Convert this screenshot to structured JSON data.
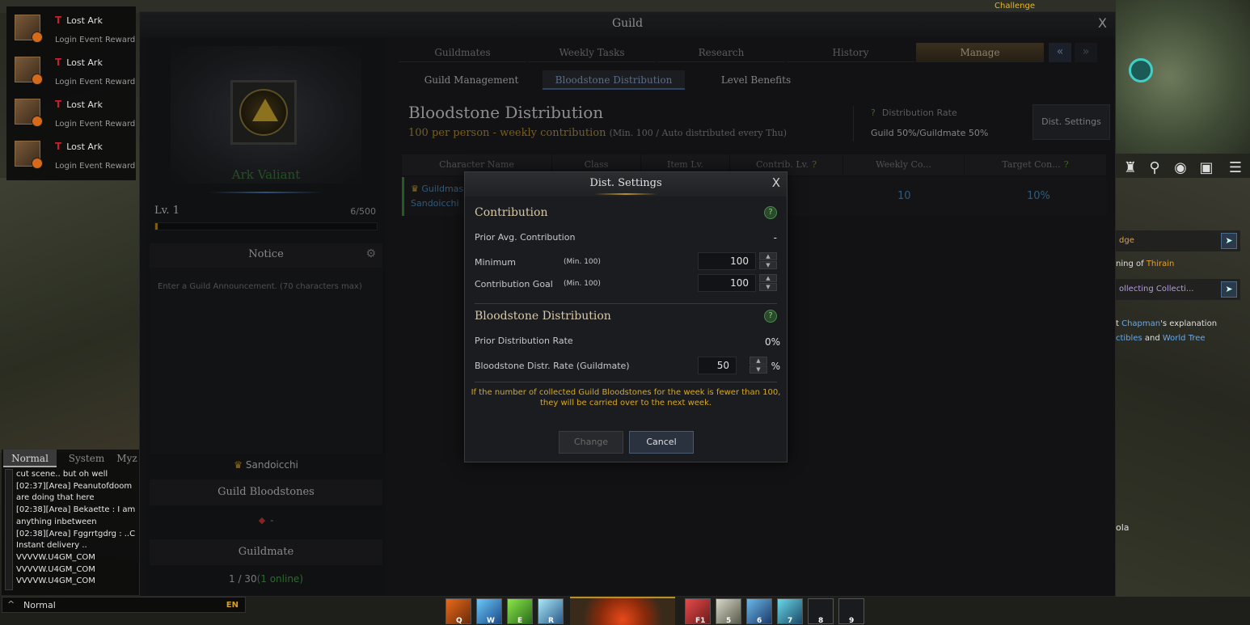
{
  "event_rewards": [
    {
      "title": "Lost Ark",
      "subtitle": "Login Event Reward"
    },
    {
      "title": "Lost Ark",
      "subtitle": "Login Event Reward"
    },
    {
      "title": "Lost Ark",
      "subtitle": "Login Event Reward"
    },
    {
      "title": "Lost Ark",
      "subtitle": "Login Event Reward"
    }
  ],
  "challenge_label": "Challenge",
  "chat": {
    "tabs": [
      "Normal",
      "System",
      "Myz"
    ],
    "lines": [
      "cut scene.. but oh well",
      "[02:37][Area] Peanutofdoom",
      "are doing that here",
      "[02:38][Area] Bekaette : I am",
      "anything inbetween",
      "[02:38][Area] Fggrrtgdrg : ..C",
      "Instant delivery ..",
      "VVVVW.U4GM_COM",
      "VVVVW.U4GM_COM",
      "VVVVW.U4GM_COM"
    ],
    "input_mode": "Normal",
    "lang": "EN"
  },
  "quest": {
    "row1": "dge",
    "row1_sub_prefix": "ning of ",
    "row1_sub_link": "Thirain",
    "row2": "ollecting Collecti...",
    "row2_sub_a": "t ",
    "row2_sub_link": "Chapman",
    "row2_sub_b": "'s explanation",
    "row3_link_a": "ctibles",
    "row3_mid": " and ",
    "row3_link_b": "World Tree",
    "side_text": "ola"
  },
  "hotbar_keys": [
    "Q",
    "W",
    "E",
    "R",
    "F1",
    "5",
    "6",
    "7",
    "8",
    "9"
  ],
  "guild_window": {
    "title": "Guild",
    "close": "X",
    "guild_name": "Ark Valiant",
    "level": "Lv. 1",
    "xp": "6/500",
    "xp_fraction": 0.012,
    "notice_title": "Notice",
    "notice_placeholder": "Enter a Guild Announcement. (70 characters max)",
    "master": "Sandoicchi",
    "bloodstones_title": "Guild Bloodstones",
    "bloodstones_value": "-",
    "guildmate_title": "Guildmate",
    "guildmate_count": "1 / 30",
    "guildmate_online": "(1 online)",
    "tabs": [
      "Guildmates",
      "Weekly Tasks",
      "Research",
      "History",
      "Manage"
    ],
    "active_tab": "Manage",
    "nav_prev": "«",
    "nav_next": "»",
    "sub_tabs": [
      "Guild Management",
      "Bloodstone Distribution",
      "Level Benefits"
    ],
    "active_sub_tab": "Bloodstone Distribution",
    "content_title": "Bloodstone Distribution",
    "content_sub": "100 per person - weekly contribution",
    "content_note": "(Min. 100 / Auto distributed every Thu)",
    "dist_rate_label": "Distribution Rate",
    "dist_rate_value": "Guild 50%/Guildmate 50%",
    "dist_settings_button": "Dist. Settings",
    "table_headers": [
      "Character Name",
      "Class",
      "Item Lv.",
      "Contrib. Lv.",
      "Weekly Co...",
      "Target Con..."
    ],
    "table_row": {
      "role": "Guildmas",
      "name": "Sandoicchi",
      "weekly": "10",
      "target": "10%"
    }
  },
  "modal": {
    "title": "Dist. Settings",
    "close": "X",
    "contribution_title": "Contribution",
    "prior_avg_label": "Prior Avg. Contribution",
    "prior_avg_value": "-",
    "minimum_label": "Minimum",
    "minimum_note": "(Min. 100)",
    "minimum_value": "100",
    "goal_label": "Contribution Goal",
    "goal_note": "(Min. 100)",
    "goal_value": "100",
    "bloodstone_title": "Bloodstone Distribution",
    "prior_rate_label": "Prior Distribution Rate",
    "prior_rate_value": "0%",
    "distr_rate_label": "Bloodstone Distr. Rate (Guildmate)",
    "distr_rate_value": "50",
    "distr_rate_unit": "%",
    "warning_line1": "If the number of collected Guild Bloodstones for the week is fewer than 100,",
    "warning_line2": "they will be carried over to the next week.",
    "change_button": "Change",
    "cancel_button": "Cancel",
    "help": "?"
  },
  "colors": {
    "accent_gold": "#b8902a",
    "online_green": "#3aa83a",
    "link_blue": "#4a8ab8",
    "warning": "#d8a820"
  }
}
